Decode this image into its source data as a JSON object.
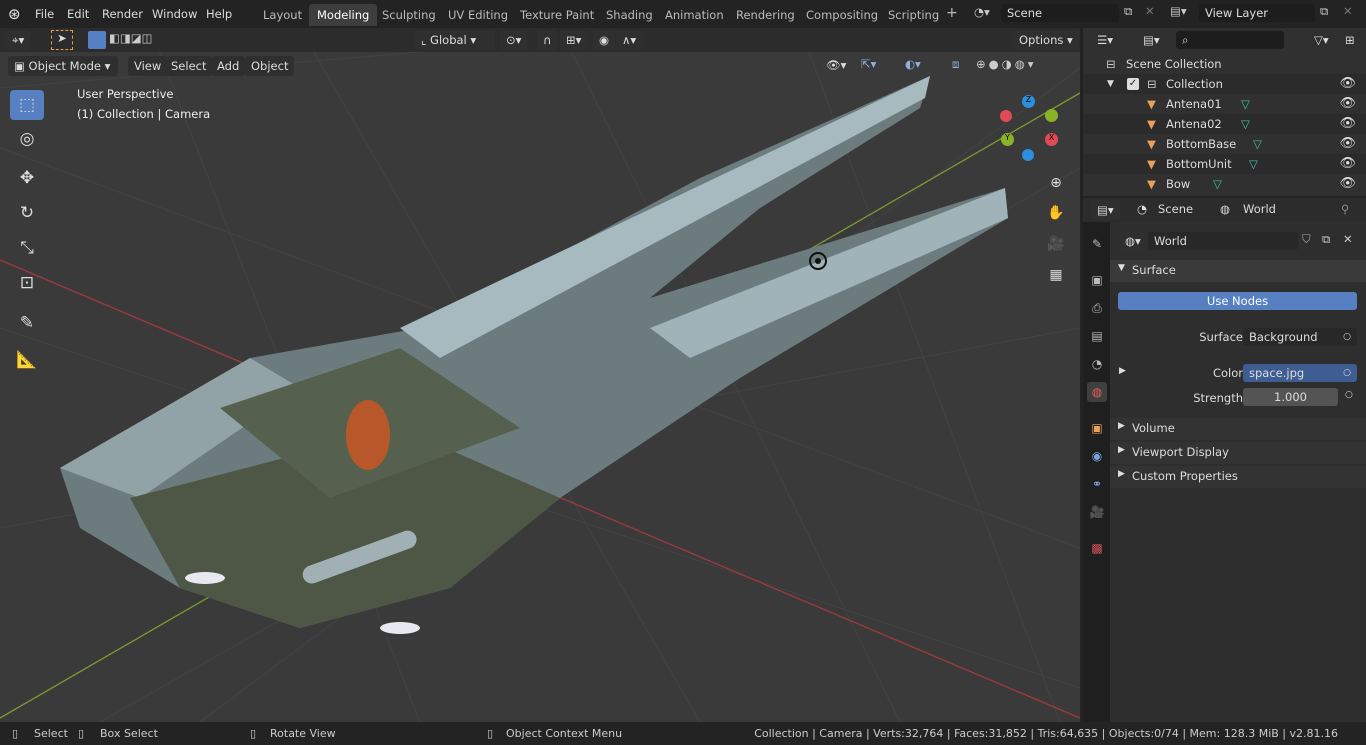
{
  "menu": [
    "File",
    "Edit",
    "Render",
    "Window",
    "Help"
  ],
  "workspaces": [
    "Layout",
    "Modeling",
    "Sculpting",
    "UV Editing",
    "Texture Paint",
    "Shading",
    "Animation",
    "Rendering",
    "Compositing",
    "Scripting"
  ],
  "active_workspace": "Modeling",
  "scene": "Scene",
  "view_layer": "View Layer",
  "toolbar": {
    "orientation": "Global",
    "options": "Options"
  },
  "viewport_header": {
    "mode": "Object Mode",
    "menus": [
      "View",
      "Select",
      "Add",
      "Object"
    ]
  },
  "overlay": {
    "line1": "User Perspective",
    "line2": "(1) Collection | Camera"
  },
  "gizmo": {
    "x": "X",
    "y": "Y",
    "z": "Z"
  },
  "outliner": {
    "root": "Scene Collection",
    "collection": "Collection",
    "items": [
      "Antena01",
      "Antena02",
      "BottomBase",
      "BottomUnit",
      "Bow"
    ]
  },
  "properties": {
    "breadcrumb": [
      "Scene",
      "World"
    ],
    "world_name": "World",
    "surface_section": "Surface",
    "use_nodes": "Use Nodes",
    "surface_label": "Surface",
    "surface_value": "Background",
    "color_label": "Color",
    "color_value": "space.jpg",
    "strength_label": "Strength",
    "strength_value": "1.000",
    "sections": [
      "Volume",
      "Viewport Display",
      "Custom Properties"
    ]
  },
  "status": {
    "select": "Select",
    "box_select": "Box Select",
    "rotate": "Rotate View",
    "context": "Object Context Menu",
    "stats": "Collection | Camera | Verts:32,764 | Faces:31,852 | Tris:64,635 | Objects:0/74 | Mem: 128.3 MiB | v2.81.16"
  },
  "colors": {
    "accent": "#5680c2",
    "bg": "#3a3a3a",
    "x_axis": "#c0383f",
    "y_axis": "#8ab229",
    "z_axis": "#2c8fdc",
    "object": "#e8a05a",
    "mesh": "#3fc1a6"
  }
}
